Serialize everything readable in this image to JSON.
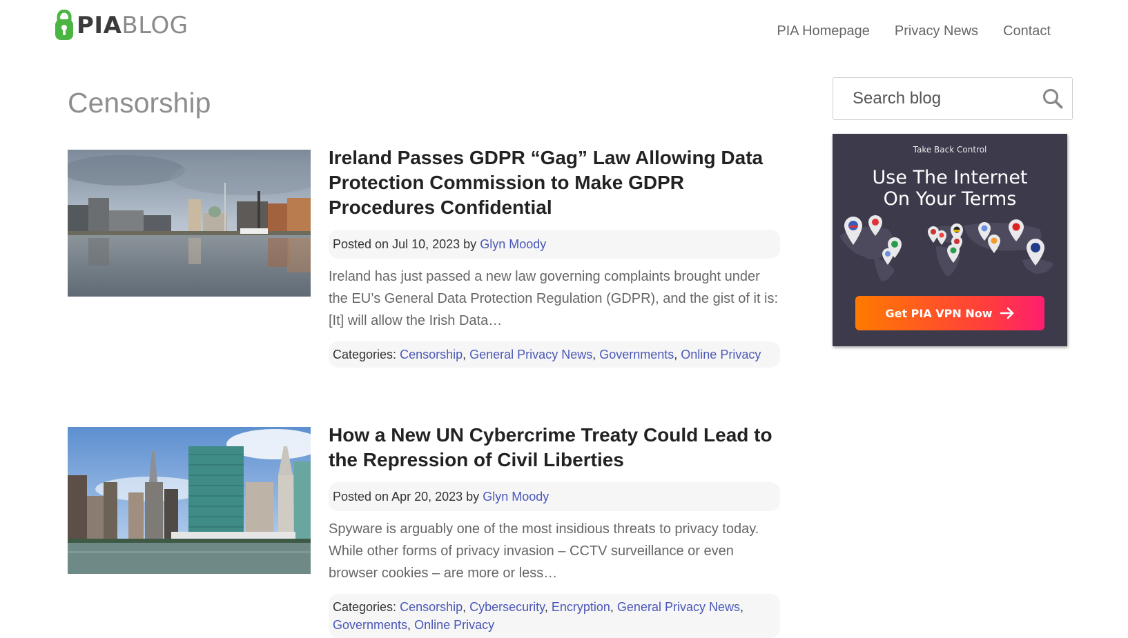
{
  "header": {
    "logo_primary": "PIA",
    "logo_secondary": "BLOG",
    "nav": [
      {
        "label": "PIA Homepage"
      },
      {
        "label": "Privacy News"
      },
      {
        "label": "Contact"
      }
    ]
  },
  "page": {
    "title": "Censorship"
  },
  "posts": [
    {
      "title": "Ireland Passes GDPR “Gag” Law Allowing Data Protection Commission to Make GDPR Procedures Confidential",
      "posted_prefix": "Posted on",
      "date": "Jul 10, 2023",
      "by": "by",
      "author": "Glyn Moody",
      "excerpt": "Ireland has just passed a new law governing complaints brought under the EU’s General Data Protection Regulation (GDPR), and the gist of it is: [It] will allow the Irish Data…",
      "categories_label": "Categories:",
      "categories": [
        "Censorship",
        "General Privacy News",
        "Governments",
        "Online Privacy"
      ]
    },
    {
      "title": "How a New UN Cybercrime Treaty Could Lead to the Repression of Civil Liberties",
      "posted_prefix": "Posted on",
      "date": "Apr 20, 2023",
      "by": "by",
      "author": "Glyn Moody",
      "excerpt": "Spyware is arguably one of the most insidious threats to privacy today. While other forms of privacy invasion – CCTV surveillance or even browser cookies – are more or less…",
      "categories_label": "Categories:",
      "categories": [
        "Censorship",
        "Cybersecurity",
        "Encryption",
        "General Privacy News",
        "Governments",
        "Online Privacy"
      ]
    }
  ],
  "sidebar": {
    "search_placeholder": "Search blog",
    "ad": {
      "kicker": "Take Back Control",
      "headline_line1": "Use The Internet",
      "headline_line2": "On Your Terms",
      "button_label": "Get PIA VPN Now"
    }
  },
  "colors": {
    "link": "#4a57b6",
    "brand_green": "#4bb543",
    "ad_background": "#3d3a4c"
  }
}
